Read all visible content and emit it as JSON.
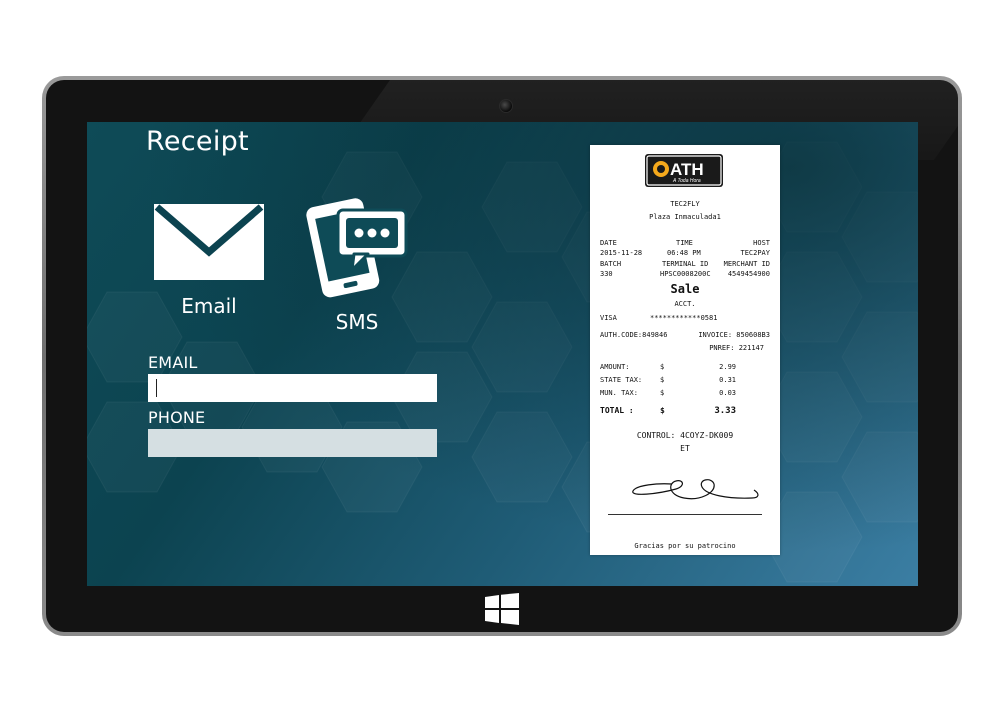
{
  "screen": {
    "title": "Receipt",
    "options": {
      "email_label": "Email",
      "sms_label": "SMS"
    },
    "form": {
      "email_label": "EMAIL",
      "email_value": "",
      "phone_label": "PHONE",
      "phone_value": ""
    }
  },
  "receipt": {
    "logo_text": "ATH",
    "logo_subtext": "A Toda Hora",
    "merchant_name": "TEC2FLY",
    "merchant_location": "Plaza Inmaculada1",
    "header_row1": [
      "DATE",
      "TIME",
      "HOST"
    ],
    "header_row2": [
      "2015-11-28",
      "06:48 PM",
      "TEC2PAY"
    ],
    "header_row3": [
      "BATCH",
      "TERMINAL ID",
      "MERCHANT ID"
    ],
    "header_row4": [
      "330",
      "HPSC0008200C",
      "4549454900"
    ],
    "transaction_type": "Sale",
    "acct_label": "ACCT.",
    "card_brand": "VISA",
    "card_number": "************0581",
    "auth_code": "AUTH.CODE:849846",
    "invoice": "INVOICE: 850608B3",
    "pnref": "PNREF:  221147",
    "amounts": [
      {
        "label": "AMOUNT:",
        "currency": "$",
        "value": "2.99"
      },
      {
        "label": "STATE TAX:",
        "currency": "$",
        "value": "0.31"
      },
      {
        "label": "MUN. TAX:",
        "currency": "$",
        "value": "0.03"
      }
    ],
    "total": {
      "label": "TOTAL :",
      "currency": "$",
      "value": "3.33"
    },
    "control": "CONTROL: 4COYZ-DK009",
    "control_suffix": "ET",
    "footer": "Gracias por su patrocino"
  },
  "icons": {
    "email": "envelope-icon",
    "sms": "phone-chat-icon",
    "windows": "windows-logo-icon",
    "camera": "camera-icon"
  },
  "colors": {
    "screen_dark": "#0c4350",
    "screen_light": "#3b7ea3",
    "phone_field_bg": "#d5dfe2",
    "icon_fill": "#ffffff"
  }
}
